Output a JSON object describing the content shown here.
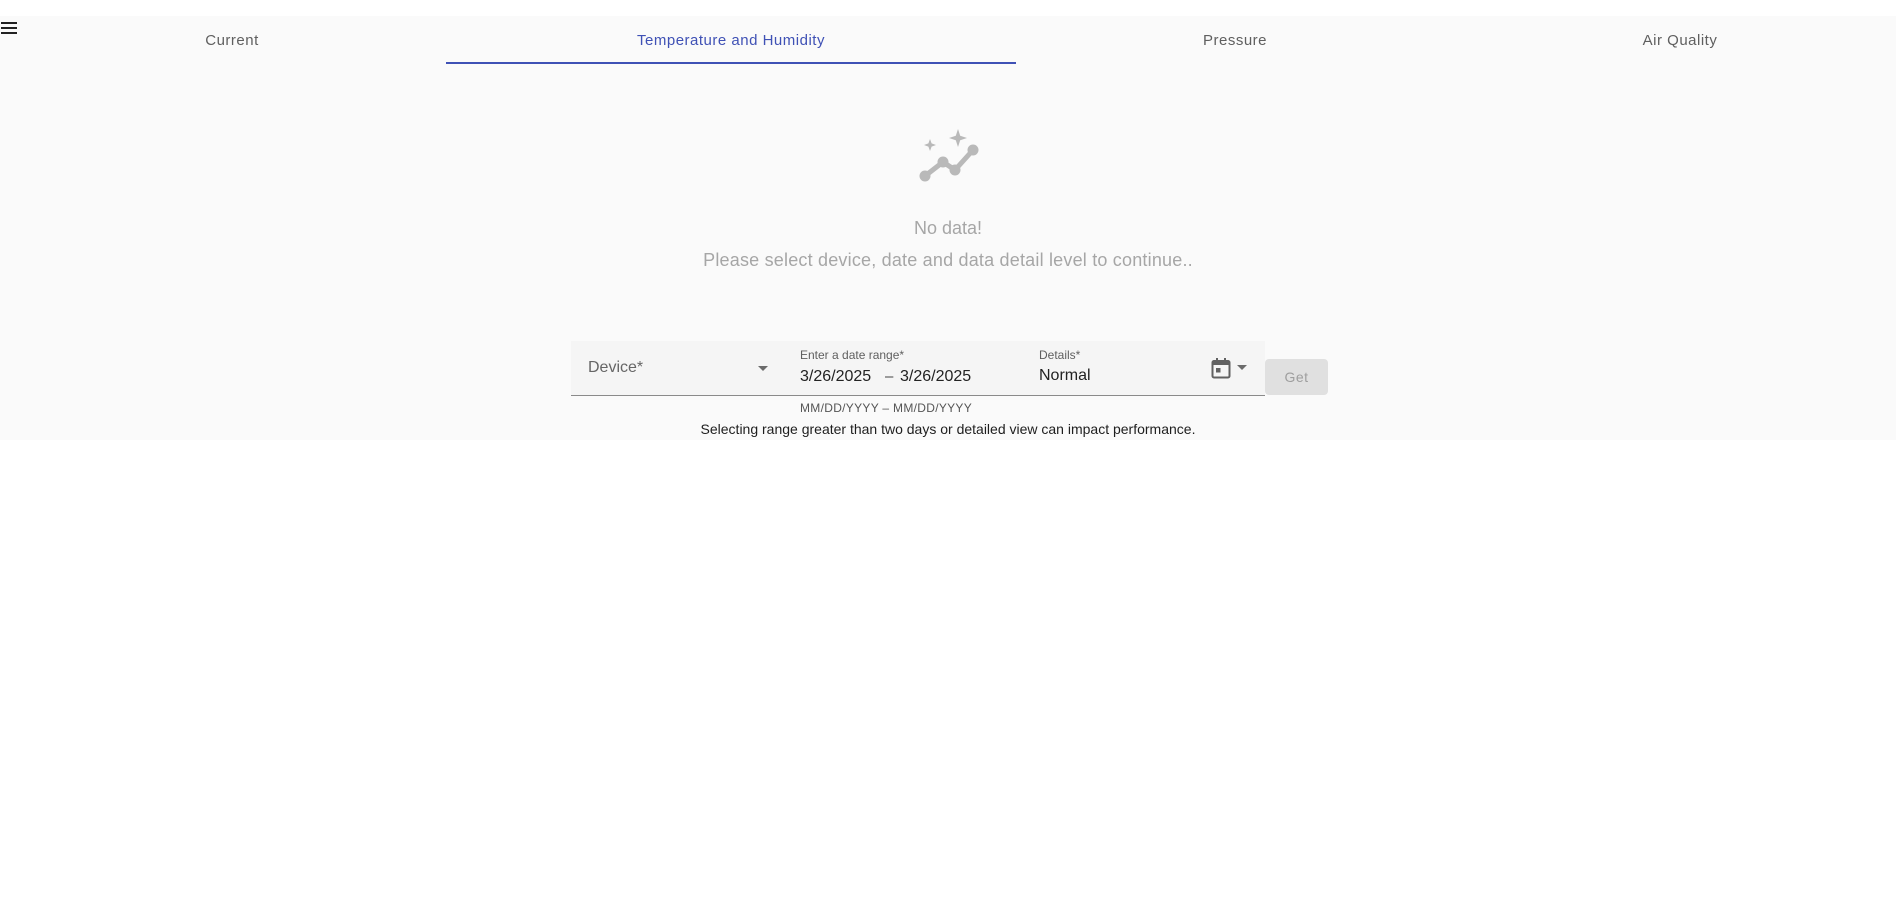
{
  "nav": {
    "menu_icon": "menu-icon",
    "tabs": [
      {
        "label": "Current",
        "active": false
      },
      {
        "label": "Temperature and Humidity",
        "active": true
      },
      {
        "label": "Pressure",
        "active": false
      },
      {
        "label": "Air Quality",
        "active": false
      }
    ]
  },
  "empty_state": {
    "icon": "sparkline-chart-icon",
    "title": "No data!",
    "subtitle": "Please select device, date and data detail level to continue.."
  },
  "form": {
    "device": {
      "label": "Device*",
      "value": ""
    },
    "date_range": {
      "label": "Enter a date range*",
      "start": "3/26/2025",
      "separator": "–",
      "end": "3/26/2025",
      "hint": "MM/DD/YYYY – MM/DD/YYYY",
      "icon": "calendar-icon"
    },
    "details": {
      "label": "Details*",
      "value": "Normal"
    },
    "get_button": "Get",
    "performance_note": "Selecting range greater than two days or detailed view can impact performance."
  },
  "colors": {
    "accent": "#3f51b5",
    "panel_background": "#fafafa",
    "muted_text": "#a6a6a6",
    "disabled_button": "#e0e0e0"
  }
}
